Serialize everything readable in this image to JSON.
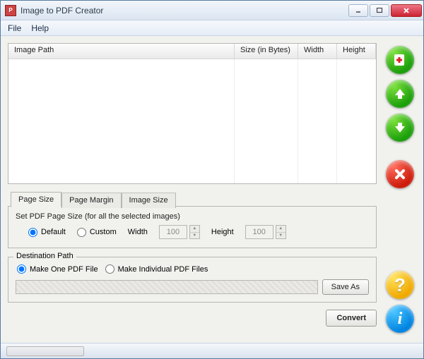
{
  "window": {
    "title": "Image to PDF Creator"
  },
  "menu": {
    "file": "File",
    "help": "Help"
  },
  "table": {
    "cols": {
      "path": "Image Path",
      "size": "Size (in Bytes)",
      "width": "Width",
      "height": "Height"
    }
  },
  "tabs": {
    "page_size": "Page Size",
    "page_margin": "Page Margin",
    "image_size": "Image Size"
  },
  "page_size": {
    "group": "Set PDF Page Size (for all the selected images)",
    "default": "Default",
    "custom": "Custom",
    "width_label": "Width",
    "width_value": "100",
    "height_label": "Height",
    "height_value": "100"
  },
  "dest": {
    "legend": "Destination Path",
    "one": "Make One PDF File",
    "many": "Make Individual PDF Files",
    "save_as": "Save As"
  },
  "buttons": {
    "convert": "Convert"
  },
  "icons": {
    "add": "add-icon",
    "up": "up-arrow-icon",
    "down": "down-arrow-icon",
    "delete": "delete-icon",
    "help": "help-icon",
    "info": "info-icon"
  }
}
